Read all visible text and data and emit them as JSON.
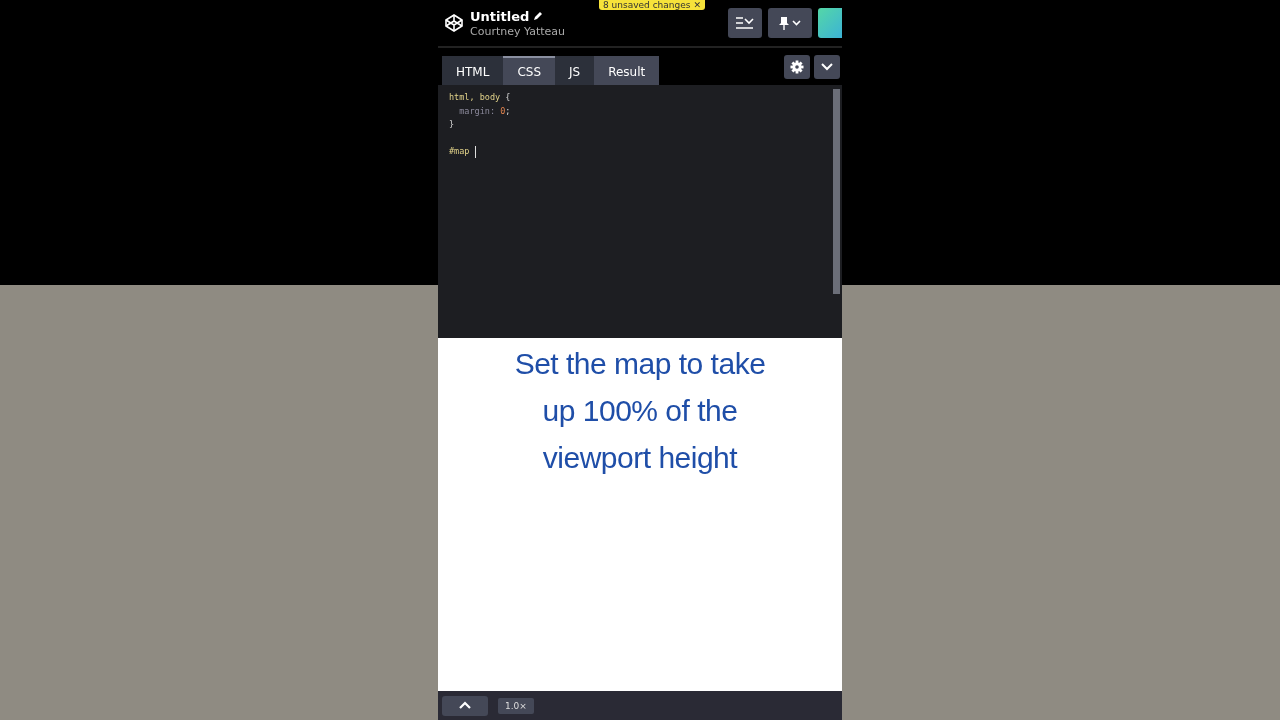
{
  "header": {
    "title": "Untitled",
    "author": "Courtney Yatteau",
    "unsaved_badge": "8 unsaved changes",
    "badge_close": "✕"
  },
  "tabs": [
    {
      "label": "HTML",
      "kind": "editor",
      "selected": false
    },
    {
      "label": "CSS",
      "kind": "editor",
      "selected": true
    },
    {
      "label": "JS",
      "kind": "editor",
      "selected": false
    },
    {
      "label": "Result",
      "kind": "result",
      "selected": false
    }
  ],
  "code": [
    {
      "tokens": [
        {
          "kind": "selector",
          "text": "html, body"
        },
        {
          "kind": "punct",
          "text": " {"
        }
      ]
    },
    {
      "tokens": [
        {
          "kind": "property",
          "text": "  margin: "
        },
        {
          "kind": "value",
          "text": "0"
        },
        {
          "kind": "punct",
          "text": ";"
        }
      ]
    },
    {
      "tokens": [
        {
          "kind": "punct",
          "text": "}"
        }
      ]
    },
    {
      "kind": "blank"
    },
    {
      "tokens": [
        {
          "kind": "selector",
          "text": "#map "
        }
      ],
      "cursor": true
    }
  ],
  "caption": "Set the map to take up 100% of the viewport height",
  "footer": {
    "zoom": "1.0×"
  }
}
